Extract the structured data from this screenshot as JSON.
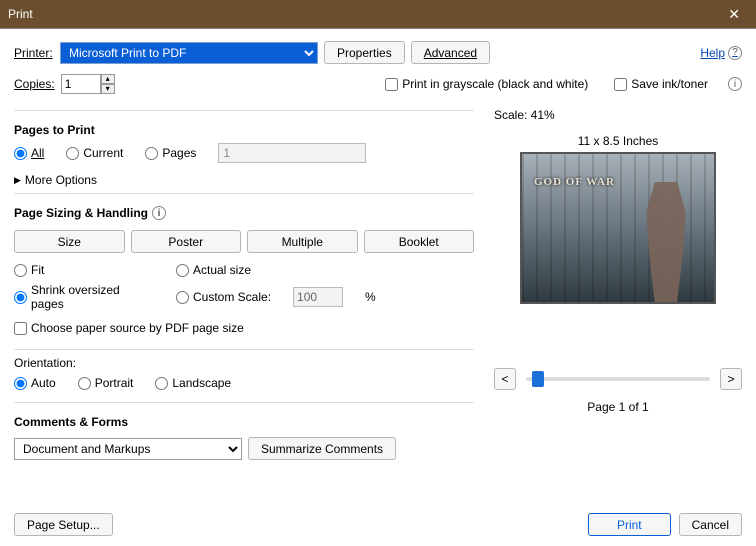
{
  "window_title": "Print",
  "help": "Help",
  "printer_label": "Printer:",
  "printer_value": "Microsoft Print to PDF",
  "properties_btn": "Properties",
  "advanced_btn": "Advanced",
  "copies_label": "Copies:",
  "copies_value": "1",
  "grayscale_label": "Print in grayscale (black and white)",
  "saveink_label": "Save ink/toner",
  "pages_to_print_hdr": "Pages to Print",
  "radios": {
    "all": "All",
    "current": "Current",
    "pages": "Pages"
  },
  "pages_input": "1",
  "more_options": "More Options",
  "sizing_hdr": "Page Sizing & Handling",
  "tabs": {
    "size": "Size",
    "poster": "Poster",
    "multiple": "Multiple",
    "booklet": "Booklet"
  },
  "fit": "Fit",
  "actual": "Actual size",
  "shrink": "Shrink oversized pages",
  "custom": "Custom Scale:",
  "custom_val": "100",
  "custom_pct": "%",
  "choose_paper": "Choose paper source by PDF page size",
  "orientation_hdr": "Orientation:",
  "orient": {
    "auto": "Auto",
    "portrait": "Portrait",
    "landscape": "Landscape"
  },
  "comments_hdr": "Comments & Forms",
  "comments_sel": "Document and Markups",
  "summarize_btn": "Summarize Comments",
  "scale_line": "Scale:  41%",
  "dims": "11 x 8.5 Inches",
  "preview_logo": "GOD OF WAR",
  "page_ind": "Page 1 of 1",
  "page_setup": "Page Setup...",
  "print_btn": "Print",
  "cancel_btn": "Cancel"
}
